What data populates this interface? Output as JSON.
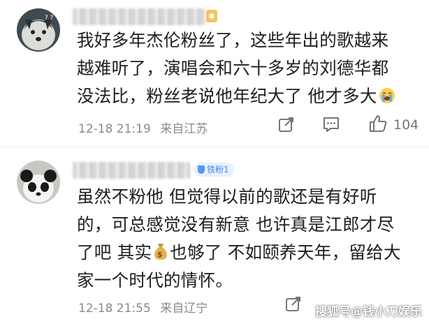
{
  "comments": [
    {
      "lines": [
        "我好多年杰伦粉丝了，这些年出的歌越来",
        "越难听了，演唱会和六十多岁的刘德华都",
        "没法比，粉丝老说他年纪大了 他才多大"
      ],
      "time": "12-18 21:19",
      "location": "来自江苏",
      "likes": "104"
    },
    {
      "badge": "铁粉1",
      "lines": [
        "虽然不粉他 但觉得以前的歌还是有好听",
        "的，可总感觉没有新意 也许真是江郎才尽",
        "了吧 其实",
        "也够了 不如颐养天年，留给大",
        "家一个时代的情怀。"
      ],
      "time": "12-18 21:55",
      "location": "来自辽宁",
      "likes": ""
    }
  ],
  "watermark": "搜狐号@钱小刀娱乐",
  "icons": {
    "forward": "forward-icon",
    "comment": "comment-icon",
    "like": "like-icon",
    "tearful": "crying-emoji-icon",
    "money": "money-bag-emoji-icon"
  }
}
